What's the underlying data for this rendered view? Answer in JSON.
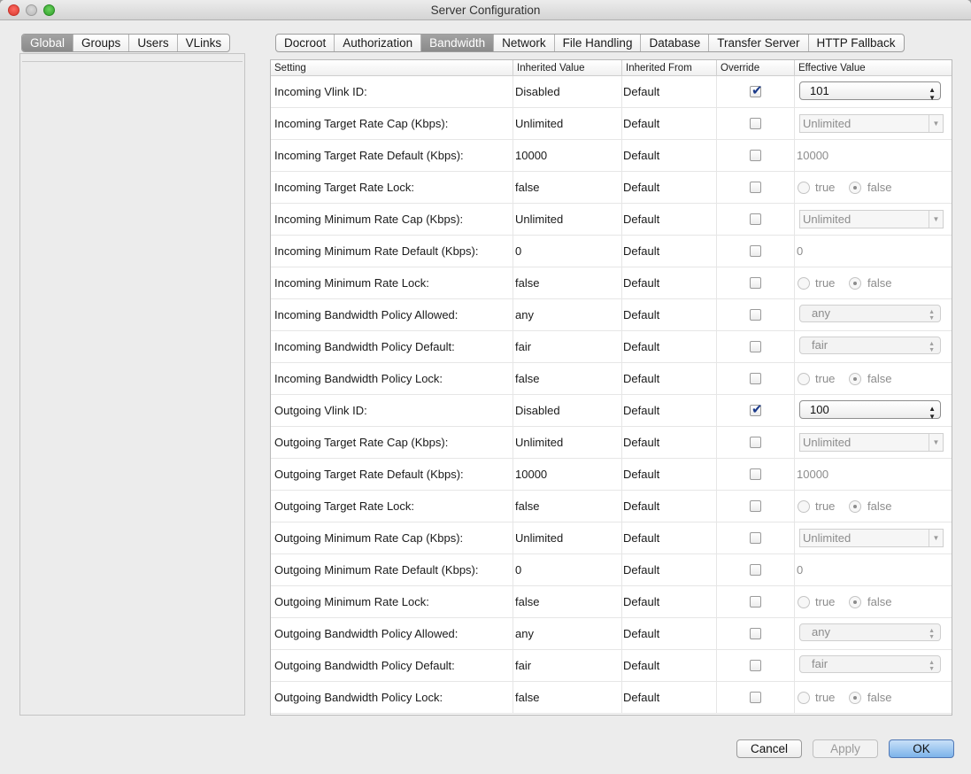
{
  "window": {
    "title": "Server Configuration"
  },
  "left_tabs": [
    "Global",
    "Groups",
    "Users",
    "VLinks"
  ],
  "left_active": "Global",
  "right_tabs": [
    "Docroot",
    "Authorization",
    "Bandwidth",
    "Network",
    "File Handling",
    "Database",
    "Transfer Server",
    "HTTP Fallback"
  ],
  "right_active": "Bandwidth",
  "columns": {
    "setting": "Setting",
    "inherited_value": "Inherited Value",
    "inherited_from": "Inherited From",
    "override": "Override",
    "effective_value": "Effective Value"
  },
  "radio_labels": {
    "true_label": "true",
    "false_label": "false"
  },
  "rows": [
    {
      "setting": "Incoming Vlink ID:",
      "inherited": "Disabled",
      "from": "Default",
      "override": true,
      "eff_type": "combo_on",
      "eff_value": "101"
    },
    {
      "setting": "Incoming Target Rate Cap (Kbps):",
      "inherited": "Unlimited",
      "from": "Default",
      "override": false,
      "eff_type": "combo_dis",
      "eff_value": "Unlimited"
    },
    {
      "setting": "Incoming Target Rate Default (Kbps):",
      "inherited": "10000",
      "from": "Default",
      "override": false,
      "eff_type": "text_dis",
      "eff_value": "10000"
    },
    {
      "setting": "Incoming Target Rate Lock:",
      "inherited": "false",
      "from": "Default",
      "override": false,
      "eff_type": "radio",
      "eff_value": "false"
    },
    {
      "setting": "Incoming Minimum Rate Cap (Kbps):",
      "inherited": "Unlimited",
      "from": "Default",
      "override": false,
      "eff_type": "combo_dis",
      "eff_value": "Unlimited"
    },
    {
      "setting": "Incoming Minimum Rate Default (Kbps):",
      "inherited": "0",
      "from": "Default",
      "override": false,
      "eff_type": "text_dis",
      "eff_value": "0"
    },
    {
      "setting": "Incoming Minimum Rate Lock:",
      "inherited": "false",
      "from": "Default",
      "override": false,
      "eff_type": "radio",
      "eff_value": "false"
    },
    {
      "setting": "Incoming Bandwidth Policy Allowed:",
      "inherited": "any",
      "from": "Default",
      "override": false,
      "eff_type": "popup_dis",
      "eff_value": "any"
    },
    {
      "setting": "Incoming Bandwidth Policy Default:",
      "inherited": "fair",
      "from": "Default",
      "override": false,
      "eff_type": "popup_dis",
      "eff_value": "fair"
    },
    {
      "setting": "Incoming Bandwidth Policy Lock:",
      "inherited": "false",
      "from": "Default",
      "override": false,
      "eff_type": "radio",
      "eff_value": "false"
    },
    {
      "setting": "Outgoing Vlink ID:",
      "inherited": "Disabled",
      "from": "Default",
      "override": true,
      "eff_type": "combo_on",
      "eff_value": "100"
    },
    {
      "setting": "Outgoing Target Rate Cap (Kbps):",
      "inherited": "Unlimited",
      "from": "Default",
      "override": false,
      "eff_type": "combo_dis",
      "eff_value": "Unlimited"
    },
    {
      "setting": "Outgoing Target Rate Default (Kbps):",
      "inherited": "10000",
      "from": "Default",
      "override": false,
      "eff_type": "text_dis",
      "eff_value": "10000"
    },
    {
      "setting": "Outgoing Target Rate Lock:",
      "inherited": "false",
      "from": "Default",
      "override": false,
      "eff_type": "radio",
      "eff_value": "false"
    },
    {
      "setting": "Outgoing Minimum Rate Cap (Kbps):",
      "inherited": "Unlimited",
      "from": "Default",
      "override": false,
      "eff_type": "combo_dis",
      "eff_value": "Unlimited"
    },
    {
      "setting": "Outgoing Minimum Rate Default (Kbps):",
      "inherited": "0",
      "from": "Default",
      "override": false,
      "eff_type": "text_dis",
      "eff_value": "0"
    },
    {
      "setting": "Outgoing Minimum Rate Lock:",
      "inherited": "false",
      "from": "Default",
      "override": false,
      "eff_type": "radio",
      "eff_value": "false"
    },
    {
      "setting": "Outgoing Bandwidth Policy Allowed:",
      "inherited": "any",
      "from": "Default",
      "override": false,
      "eff_type": "popup_dis",
      "eff_value": "any"
    },
    {
      "setting": "Outgoing Bandwidth Policy Default:",
      "inherited": "fair",
      "from": "Default",
      "override": false,
      "eff_type": "popup_dis",
      "eff_value": "fair"
    },
    {
      "setting": "Outgoing Bandwidth Policy Lock:",
      "inherited": "false",
      "from": "Default",
      "override": false,
      "eff_type": "radio",
      "eff_value": "false"
    }
  ],
  "buttons": {
    "cancel": "Cancel",
    "apply": "Apply",
    "ok": "OK"
  },
  "icons": {
    "checkmark": "checkmark-icon",
    "combo_arrows": "up-down-arrows-icon",
    "dropdown_arrow": "chevron-down-icon"
  },
  "colors": {
    "active_tab": "#8f8f8f",
    "ok_button": "#7cb3ea",
    "check": "#1b3a8a"
  }
}
